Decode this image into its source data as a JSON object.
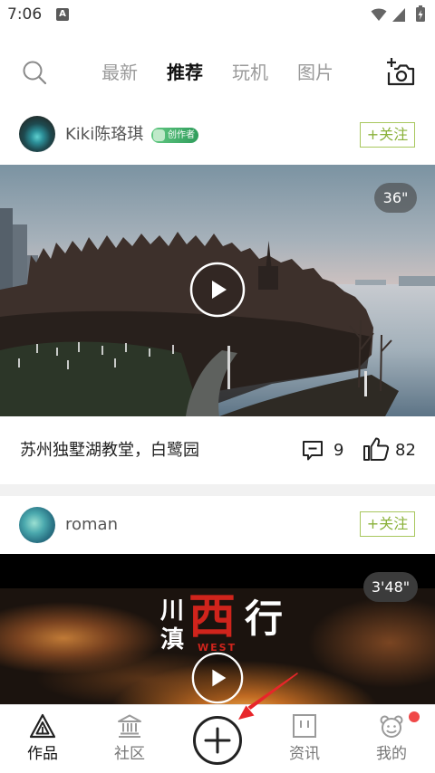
{
  "status_bar": {
    "time": "7:06",
    "notification_glyph": "A",
    "icons": [
      "wifi-icon",
      "signal-icon",
      "battery-charging-icon"
    ]
  },
  "header": {
    "search_icon": "search-icon",
    "tabs": [
      {
        "label": "最新",
        "active": false
      },
      {
        "label": "推荐",
        "active": true
      },
      {
        "label": "玩机",
        "active": false
      },
      {
        "label": "图片",
        "active": false
      }
    ],
    "camera_icon": "camera-add-icon"
  },
  "feed": {
    "posts": [
      {
        "author": "Kiki陈珞琪",
        "badge": "创作者",
        "follow_label": "+关注",
        "video_duration": "36\"",
        "caption": "苏州独墅湖教堂，白鹭园",
        "comment_count": "9",
        "like_count": "82"
      },
      {
        "author": "roman",
        "follow_label": "+关注",
        "video_duration": "3'48\"",
        "thumbnail_title": {
          "left_top": "川",
          "left_bottom": "滇",
          "center": "西",
          "right": "行",
          "subtitle": "WEST"
        }
      }
    ]
  },
  "bottom_nav": {
    "items": [
      {
        "label": "作品",
        "icon": "works-triangle-icon",
        "active": true
      },
      {
        "label": "社区",
        "icon": "community-building-icon",
        "active": false
      },
      {
        "label": "资讯",
        "icon": "news-square-icon",
        "active": false
      },
      {
        "label": "我的",
        "icon": "profile-face-icon",
        "active": false,
        "has_notification_dot": true
      }
    ],
    "create_button_icon": "plus-icon"
  },
  "colors": {
    "accent_green": "#8ab13a",
    "badge_green": "#3aa864",
    "notification_red": "#f04848",
    "annotation_red": "#e8262a",
    "active_text": "#111111",
    "inactive_text": "#999999"
  }
}
